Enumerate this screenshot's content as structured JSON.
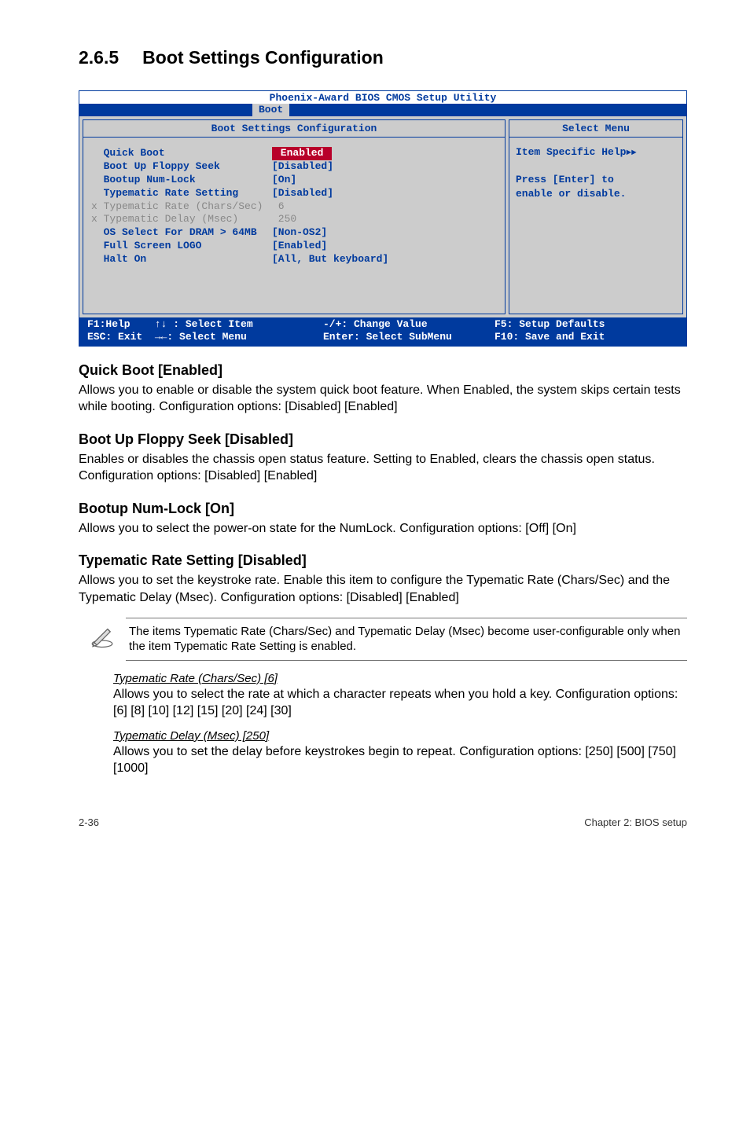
{
  "section": {
    "number": "2.6.5",
    "title": "Boot Settings Configuration"
  },
  "bios": {
    "title": "Phoenix-Award BIOS CMOS Setup Utility",
    "tab": "Boot",
    "left_header": "Boot Settings Configuration",
    "right_header": "Select Menu",
    "rows": [
      {
        "prefix": "  ",
        "label": "Quick Boot",
        "value_selected": "Enabled",
        "gray": false
      },
      {
        "prefix": "  ",
        "label": "Boot Up Floppy Seek",
        "value": "[Disabled]",
        "gray": false
      },
      {
        "prefix": "  ",
        "label": "Bootup Num-Lock",
        "value": "[On]",
        "gray": false
      },
      {
        "prefix": "  ",
        "label": "Typematic Rate Setting",
        "value": "[Disabled]",
        "gray": false
      },
      {
        "prefix": "x ",
        "label": "Typematic Rate (Chars/Sec)",
        "value": " 6",
        "gray": true
      },
      {
        "prefix": "x ",
        "label": "Typematic Delay (Msec)",
        "value": " 250",
        "gray": true
      },
      {
        "prefix": "  ",
        "label": "OS Select For DRAM > 64MB",
        "value": "[Non-OS2]",
        "gray": false
      },
      {
        "prefix": "  ",
        "label": "Full Screen LOGO",
        "value": "[Enabled]",
        "gray": false
      },
      {
        "prefix": "  ",
        "label": "Halt On",
        "value": "[All, But keyboard]",
        "gray": false
      }
    ],
    "help": {
      "line1": "Item Specific Help",
      "line2": "Press [Enter] to",
      "line3": "enable or disable."
    },
    "footer": {
      "c1a": "F1:Help    ↑↓ : Select Item",
      "c1b": "ESC: Exit  →←: Select Menu",
      "c2a": "-/+: Change Value",
      "c2b": "Enter: Select SubMenu",
      "c3a": "F5: Setup Defaults",
      "c3b": "F10: Save and Exit"
    }
  },
  "subs": {
    "quickboot": {
      "h": "Quick Boot [Enabled]",
      "p": "Allows you to enable or disable the system quick boot feature. When Enabled, the system skips certain tests while booting. Configuration options: [Disabled] [Enabled]"
    },
    "floppy": {
      "h": "Boot Up Floppy Seek [Disabled]",
      "p": "Enables or disables the chassis open status feature. Setting to Enabled, clears the chassis open status. Configuration options: [Disabled] [Enabled]"
    },
    "numlock": {
      "h": "Bootup Num-Lock [On]",
      "p": "Allows you to select the power-on state for the NumLock. Configuration options: [Off] [On]"
    },
    "typrate": {
      "h": "Typematic Rate Setting [Disabled]",
      "p": "Allows you to set the keystroke rate. Enable this item to configure the Typematic Rate (Chars/Sec) and the Typematic Delay (Msec). Configuration options: [Disabled] [Enabled]"
    }
  },
  "note": "The items Typematic Rate (Chars/Sec) and Typematic Delay (Msec) become user-configurable only when the item Typematic Rate Setting is enabled.",
  "indents": {
    "rate": {
      "h": "Typematic Rate (Chars/Sec) [6] ",
      "p": "Allows you to select the rate at which a character repeats when you hold a key. Configuration options: [6] [8] [10] [12] [15] [20] [24] [30]"
    },
    "delay": {
      "h": "Typematic Delay (Msec) [250]",
      "p": "Allows you to set the delay before keystrokes begin to repeat. Configuration options: [250] [500] [750] [1000]"
    }
  },
  "footer": {
    "left": "2-36",
    "right": "Chapter 2: BIOS setup"
  }
}
